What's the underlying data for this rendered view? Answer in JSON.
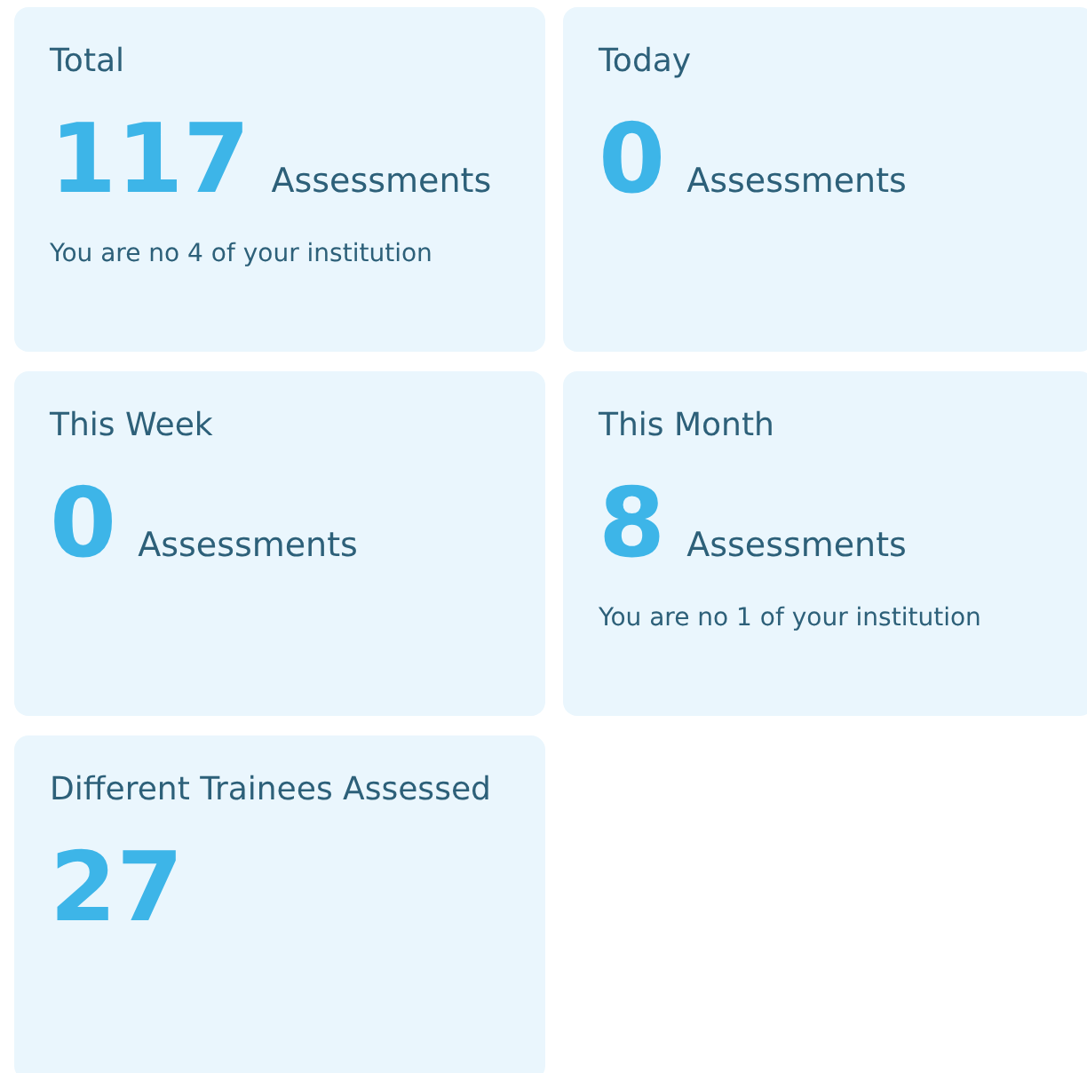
{
  "cards": [
    {
      "title": "Total",
      "value": "117",
      "unit": "Assessments",
      "note": "You are no 4 of your institution"
    },
    {
      "title": "Today",
      "value": "0",
      "unit": "Assessments"
    },
    {
      "title": "This Week",
      "value": "0",
      "unit": "Assessments"
    },
    {
      "title": "This Month",
      "value": "8",
      "unit": "Assessments",
      "note": "You are no 1 of your institution"
    },
    {
      "title": "Different Trainees Assessed",
      "value": "27"
    }
  ]
}
